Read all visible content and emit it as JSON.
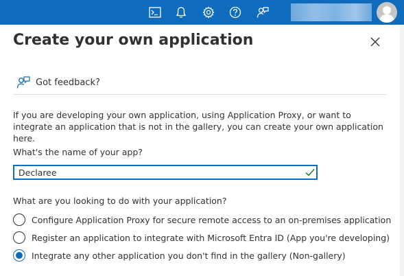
{
  "topbar": {
    "icons": [
      "cloud-shell-icon",
      "notifications-bell-icon",
      "settings-gear-icon",
      "help-question-icon",
      "feedback-person-icon"
    ]
  },
  "panel": {
    "title": "Create your own application",
    "feedback_label": "Got feedback?",
    "intro": "If you are developing your own application, using Application Proxy, or want to integrate an application that is not in the gallery, you can create your own application here.",
    "name_label": "What's the name of your app?",
    "name_value": "Declaree",
    "question": "What are you looking to do with your application?",
    "options": [
      {
        "label": "Configure Application Proxy for secure remote access to an on-premises application",
        "selected": false
      },
      {
        "label": "Register an application to integrate with Microsoft Entra ID (App you're developing)",
        "selected": false
      },
      {
        "label": "Integrate any other application you don't find in the gallery (Non-gallery)",
        "selected": true
      }
    ]
  },
  "colors": {
    "brand": "#0f6cbd",
    "valid_check": "#107c10",
    "text": "#323130"
  }
}
